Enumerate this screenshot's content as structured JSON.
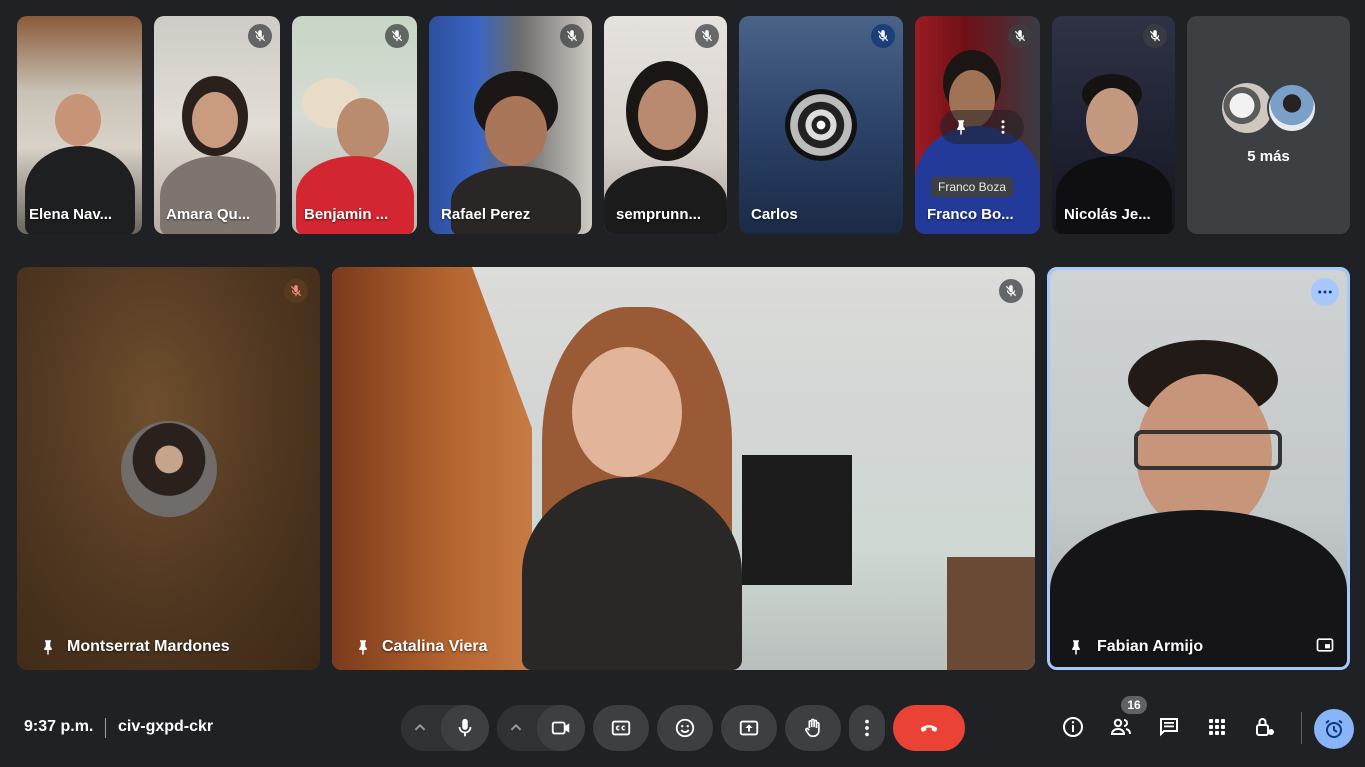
{
  "top_strip": {
    "participants": [
      {
        "name": "Elena Nav...",
        "muted": false
      },
      {
        "name": "Amara Qu...",
        "muted": true
      },
      {
        "name": "Benjamin ...",
        "muted": true
      },
      {
        "name": "Rafael Perez",
        "muted": true
      },
      {
        "name": "semprunn...",
        "muted": true
      },
      {
        "name": "Carlos",
        "muted": true
      },
      {
        "name": "Franco Bo...",
        "muted": true
      },
      {
        "name": "Nicolás Je...",
        "muted": true
      }
    ],
    "more_label": "5 más"
  },
  "tooltip": "Franco Boza",
  "main": {
    "left": {
      "name": "Montserrat Mardones"
    },
    "center": {
      "name": "Catalina Viera"
    },
    "right": {
      "name": "Fabian Armijo"
    }
  },
  "toolbar": {
    "time": "9:37 p.m.",
    "meeting_code": "civ-gxpd-ckr",
    "participant_count": "16"
  },
  "colors": {
    "background": "#202124",
    "hangup": "#ea4335",
    "accent": "#8ab4f8"
  }
}
